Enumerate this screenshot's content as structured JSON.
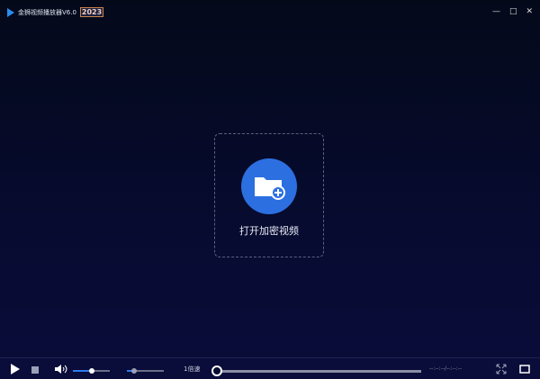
{
  "title": {
    "app_name": "金狮视频播放器V6.0",
    "badge": "2023"
  },
  "window_controls": {
    "minimize": "—",
    "maximize": "□",
    "close": "✕"
  },
  "center": {
    "open_label": "打开加密视频"
  },
  "controls": {
    "volume_fraction": 0.5,
    "speed_slider_fraction": 0.2,
    "speed_label": "1倍速",
    "progress_fraction": 0,
    "time": "--:--:--/--:--:--"
  }
}
